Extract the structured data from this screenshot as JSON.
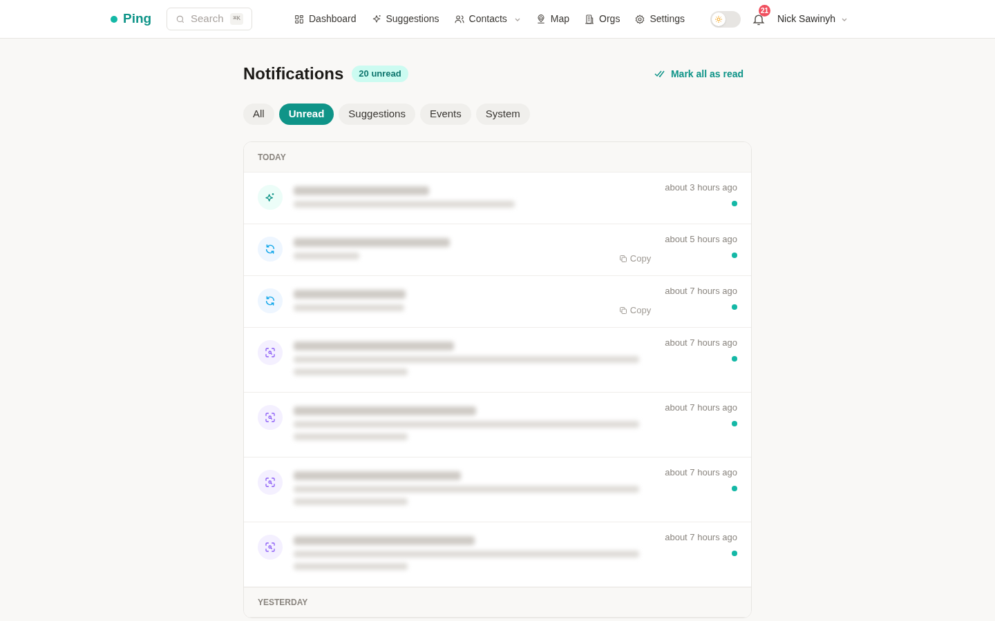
{
  "brand": {
    "name": "Ping"
  },
  "search": {
    "placeholder": "Search",
    "shortcut": "⌘K"
  },
  "nav": [
    {
      "label": "Dashboard",
      "dropdown": false
    },
    {
      "label": "Suggestions",
      "dropdown": false
    },
    {
      "label": "Contacts",
      "dropdown": true
    },
    {
      "label": "Map",
      "dropdown": false
    },
    {
      "label": "Orgs",
      "dropdown": false
    },
    {
      "label": "Settings",
      "dropdown": false
    }
  ],
  "theme_toggle": {
    "on": false
  },
  "notifications_badge": "21",
  "user": {
    "name": "Nick Sawinyh"
  },
  "page": {
    "title": "Notifications",
    "unread_badge": "20 unread",
    "mark_all": "Mark all as read"
  },
  "filters": [
    {
      "label": "All",
      "selected": false
    },
    {
      "label": "Unread",
      "selected": true
    },
    {
      "label": "Suggestions",
      "selected": false
    },
    {
      "label": "Events",
      "selected": false
    },
    {
      "label": "System",
      "selected": false
    }
  ],
  "sections": [
    {
      "title": "TODAY",
      "items": [
        {
          "kind": "suggestion",
          "time": "about 3 hours ago",
          "unread": true
        },
        {
          "kind": "sync",
          "time": "about 5 hours ago",
          "unread": true,
          "copy": "Copy"
        },
        {
          "kind": "sync",
          "time": "about 7 hours ago",
          "unread": true,
          "copy": "Copy"
        },
        {
          "kind": "scan",
          "time": "about 7 hours ago",
          "unread": true
        },
        {
          "kind": "scan",
          "time": "about 7 hours ago",
          "unread": true
        },
        {
          "kind": "scan",
          "time": "about 7 hours ago",
          "unread": true
        },
        {
          "kind": "scan",
          "time": "about 7 hours ago",
          "unread": true
        }
      ]
    },
    {
      "title": "YESTERDAY"
    }
  ]
}
